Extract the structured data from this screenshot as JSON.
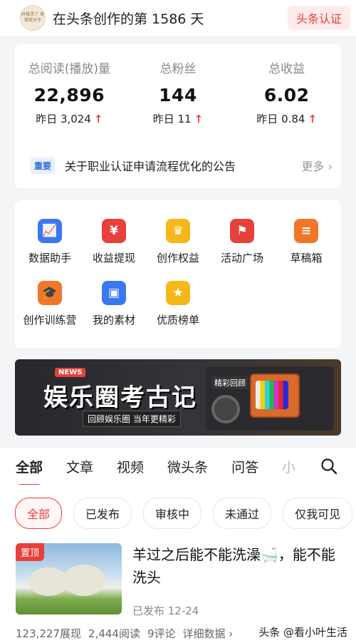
{
  "header": {
    "avatar_text": "时栈寻了 发卷航分子",
    "title": "在头条创作的第 1586 天",
    "cert_button": "头条认证"
  },
  "stats": [
    {
      "label": "总阅读(播放)量",
      "value": "22,896",
      "sub": "昨日 3,024",
      "arrow": "↑"
    },
    {
      "label": "总粉丝",
      "value": "144",
      "sub": "昨日 11",
      "arrow": "↑"
    },
    {
      "label": "总收益",
      "value": "6.02",
      "sub": "昨日 0.84",
      "arrow": "↑"
    }
  ],
  "notice": {
    "tag": "重要",
    "text": "关于职业认证申请流程优化的公告",
    "more": "更多 ›"
  },
  "tools": [
    {
      "label": "数据助手",
      "icon": "chart-icon",
      "color": "#3a78f2",
      "glyph": "📈"
    },
    {
      "label": "收益提现",
      "icon": "yen-icon",
      "color": "#e8403a",
      "glyph": "¥"
    },
    {
      "label": "创作权益",
      "icon": "crown-icon",
      "color": "#f5b81a",
      "glyph": "♛"
    },
    {
      "label": "活动广场",
      "icon": "flag-icon",
      "color": "#e8403a",
      "glyph": "⚑"
    },
    {
      "label": "草稿箱",
      "icon": "draft-icon",
      "color": "#f0772a",
      "glyph": "≡"
    },
    {
      "label": "创作训练营",
      "icon": "graduation-cap-icon",
      "color": "#f0772a",
      "glyph": "🎓"
    },
    {
      "label": "我的素材",
      "icon": "image-icon",
      "color": "#3a78f2",
      "glyph": "▣"
    },
    {
      "label": "优质榜单",
      "icon": "medal-icon",
      "color": "#f5b81a",
      "glyph": "★"
    }
  ],
  "banner": {
    "tag": "NEWS",
    "title": "娱乐圈考古记",
    "subtitle": "回顾娱乐圈 当年更精彩",
    "right_label": "精彩回顾"
  },
  "tabs": [
    {
      "label": "全部",
      "active": true
    },
    {
      "label": "文章",
      "active": false
    },
    {
      "label": "视频",
      "active": false
    },
    {
      "label": "微头条",
      "active": false
    },
    {
      "label": "问答",
      "active": false
    },
    {
      "label": "小",
      "active": false
    }
  ],
  "filters": [
    {
      "label": "全部",
      "active": true
    },
    {
      "label": "已发布",
      "active": false
    },
    {
      "label": "审核中",
      "active": false
    },
    {
      "label": "未通过",
      "active": false
    },
    {
      "label": "仅我可见",
      "active": false
    }
  ],
  "article": {
    "pin_badge": "置顶",
    "title": "羊过之后能不能洗澡🛁，能不能洗头",
    "status": "已发布  12-24",
    "metrics": [
      "123,227展现",
      "2,444阅读",
      "9评论",
      "详细数据 ›"
    ]
  },
  "watermark": "头条 @看小叶生活",
  "colors": {
    "accent": "#e8403a",
    "blue": "#3a78f2",
    "background": "#f4f5f7"
  }
}
